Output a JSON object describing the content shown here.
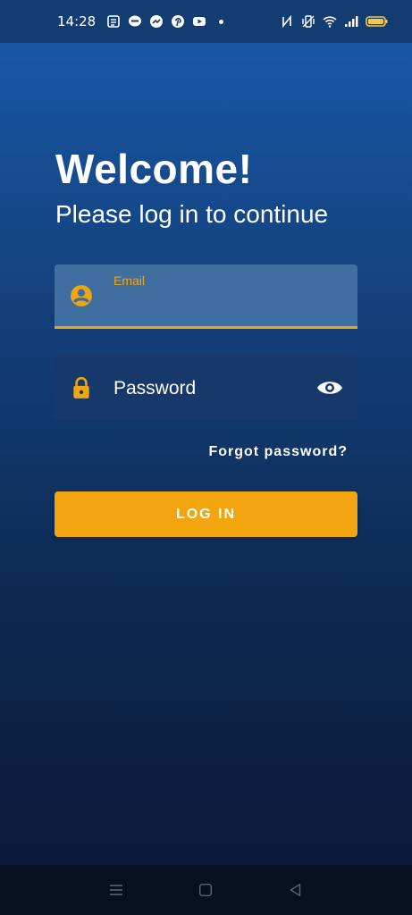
{
  "status_bar": {
    "time": "14:28",
    "notification_icons": [
      "notes-icon",
      "line-icon",
      "messenger-icon",
      "pinterest-icon",
      "youtube-icon"
    ],
    "system_icons": [
      "nfc-icon",
      "vibrate-icon",
      "wifi-icon",
      "signal-icon",
      "battery-icon"
    ]
  },
  "welcome": {
    "title": "Welcome!",
    "subtitle": "Please log in to continue"
  },
  "email_field": {
    "label": "Email",
    "value": "",
    "icon": "account-circle-icon"
  },
  "password_field": {
    "placeholder": "Password",
    "icon": "lock-icon",
    "toggle_icon": "eye-icon"
  },
  "forgot_password": "Forgot password?",
  "login_button": "LOG IN",
  "nav_bar": {
    "icons": [
      "menu-icon",
      "home-square-icon",
      "back-triangle-icon"
    ]
  },
  "colors": {
    "accent": "#f2a50e",
    "background_top": "#1a5aab",
    "background_bottom": "#091733"
  }
}
